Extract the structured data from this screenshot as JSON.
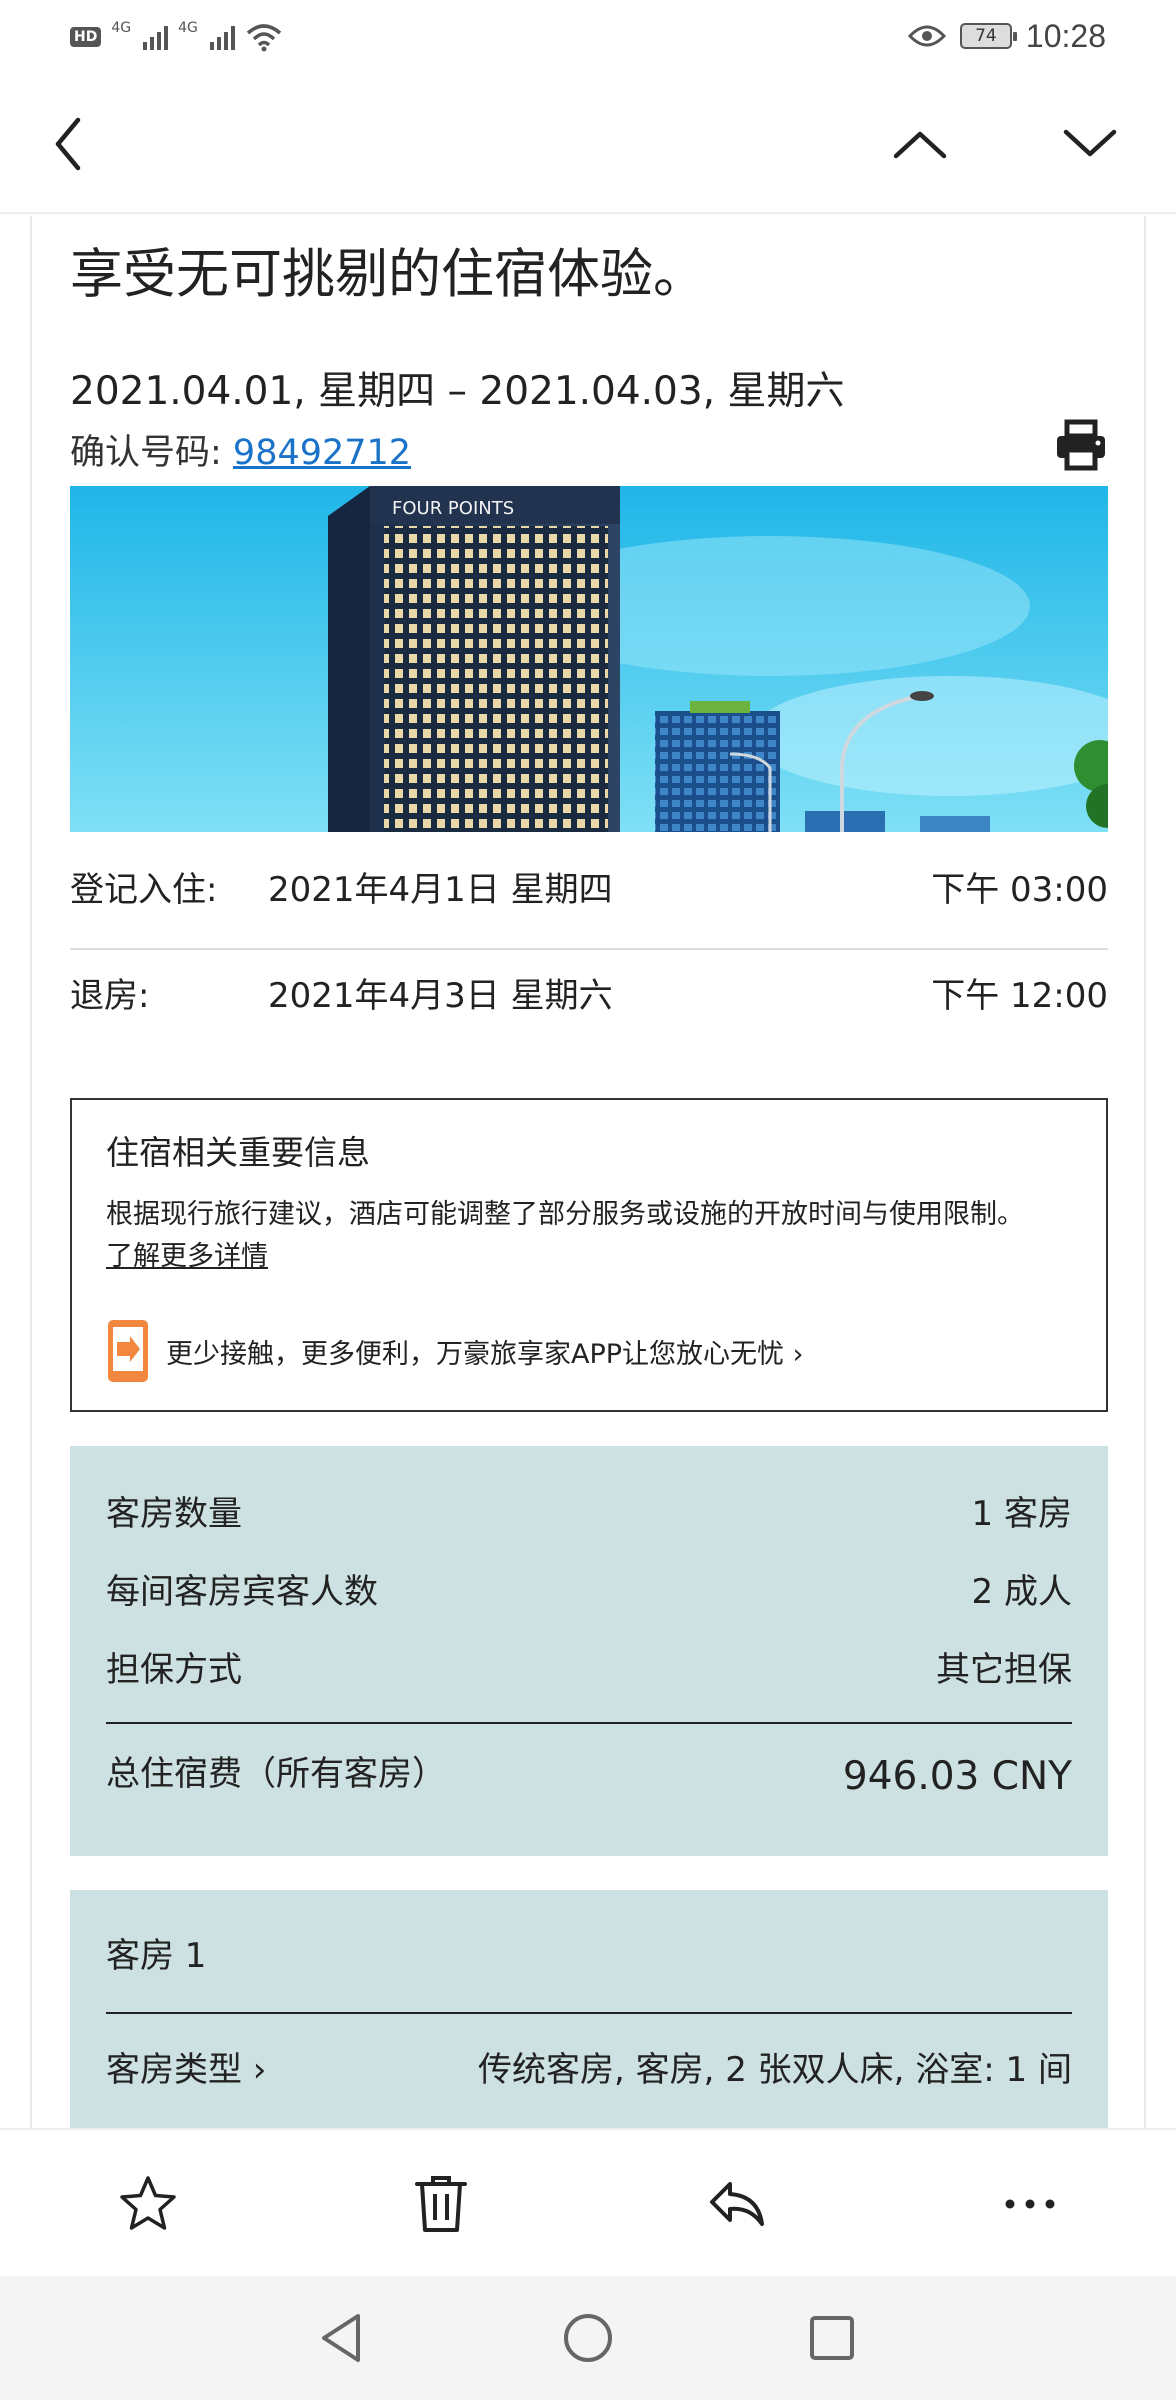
{
  "status_bar": {
    "hd": "HD",
    "network_1": "4G",
    "network_2": "4G",
    "battery": "74",
    "time": "10:28"
  },
  "headline": "享受无可挑剔的住宿体验。",
  "stay_dates": "2021.04.01, 星期四 – 2021.04.03, 星期六",
  "confirmation": {
    "label": "确认号码: ",
    "number": "98492712"
  },
  "check_in": {
    "label": "登记入住:",
    "date": "2021年4月1日 星期四",
    "time": "下午 03:00"
  },
  "check_out": {
    "label": "退房:",
    "date": "2021年4月3日 星期六",
    "time": "下午 12:00"
  },
  "info_box": {
    "title": "住宿相关重要信息",
    "text": "根据现行旅行建议，酒店可能调整了部分服务或设施的开放时间与使用限制。",
    "link": "了解更多详情",
    "promo": "更少接触，更多便利，万豪旅享家APP让您放心无忧 ›"
  },
  "summary": {
    "rooms_label": "客房数量",
    "rooms_value": "1 客房",
    "guests_label": "每间客房宾客人数",
    "guests_value": "2 成人",
    "guarantee_label": "担保方式",
    "guarantee_value": "其它担保",
    "total_label": "总住宿费（所有客房）",
    "total_value": "946.03 CNY"
  },
  "room": {
    "title": "客房 1",
    "type_label": "客房类型 ›",
    "type_value": "传统客房, 客房, 2 张双人床, 浴室: 1 间"
  },
  "hero_sign": "FOUR POINTS",
  "colors": {
    "link": "#1a73c8",
    "summary_bg": "#cde0e2",
    "promo_orange": "#f2873f",
    "sky": "#2cc4ec"
  },
  "icons": {
    "back": "back-arrow-icon",
    "prev": "chevron-up-icon",
    "next": "chevron-down-icon",
    "print": "printer-icon",
    "promo": "phone-app-icon",
    "star": "star-icon",
    "delete": "trash-icon",
    "reply": "reply-icon",
    "more": "more-icon"
  }
}
